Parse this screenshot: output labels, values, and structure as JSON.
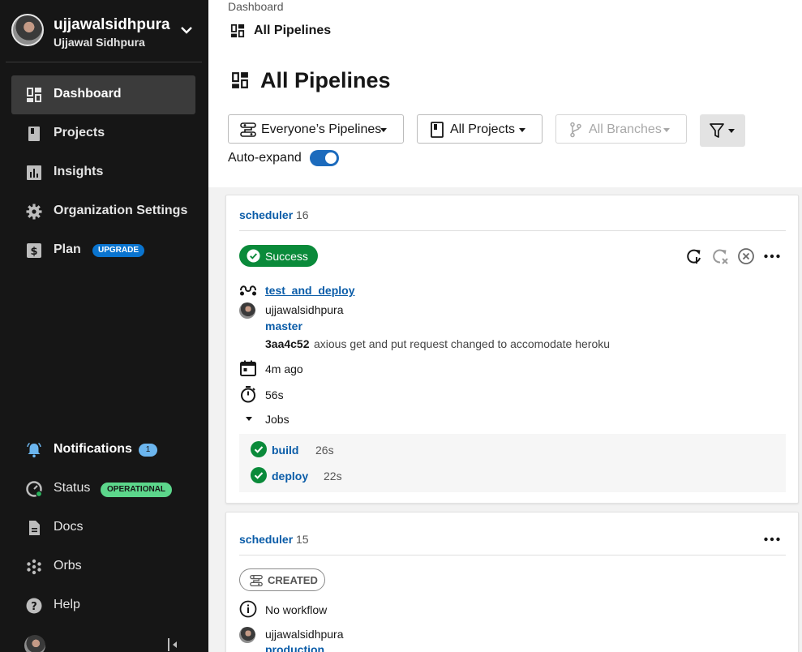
{
  "user": {
    "username": "ujjawalsidhpura",
    "full_name": "Ujjawal Sidhpura"
  },
  "sidebar": {
    "items": [
      {
        "label": "Dashboard"
      },
      {
        "label": "Projects"
      },
      {
        "label": "Insights"
      },
      {
        "label": "Organization Settings"
      },
      {
        "label": "Plan",
        "badge": "UPGRADE"
      }
    ],
    "bottom": [
      {
        "label": "Notifications",
        "badge": "1"
      },
      {
        "label": "Status",
        "badge": "OPERATIONAL"
      },
      {
        "label": "Docs"
      },
      {
        "label": "Orbs"
      },
      {
        "label": "Help"
      }
    ]
  },
  "breadcrumb": {
    "root": "Dashboard",
    "page": "All Pipelines"
  },
  "page": {
    "title": "All Pipelines"
  },
  "filters": {
    "pipelines": "Everyone’s Pipelines",
    "projects": "All Projects",
    "branches": "All Branches",
    "auto_expand_label": "Auto-expand",
    "auto_expand_on": true
  },
  "pipelines": [
    {
      "project": "scheduler",
      "number": "16",
      "status": "Success",
      "workflow": "test_and_deploy",
      "author": "ujjawalsidhpura",
      "branch": "master",
      "commit_sha": "3aa4c52",
      "commit_message": "axious get and put request changed to accomodate heroku",
      "time_ago": "4m ago",
      "duration": "56s",
      "jobs_label": "Jobs",
      "jobs": [
        {
          "name": "build",
          "duration": "26s"
        },
        {
          "name": "deploy",
          "duration": "22s"
        }
      ]
    },
    {
      "project": "scheduler",
      "number": "15",
      "status": "CREATED",
      "workflow": "No workflow",
      "author": "ujjawalsidhpura",
      "branch": "production"
    }
  ],
  "colors": {
    "sidebar_bg": "#161616",
    "success": "#0a8a3a",
    "link": "#0a5ca8",
    "toggle": "#1c6bbd",
    "upgrade": "#0a74cf",
    "operational": "#5cd68b"
  }
}
